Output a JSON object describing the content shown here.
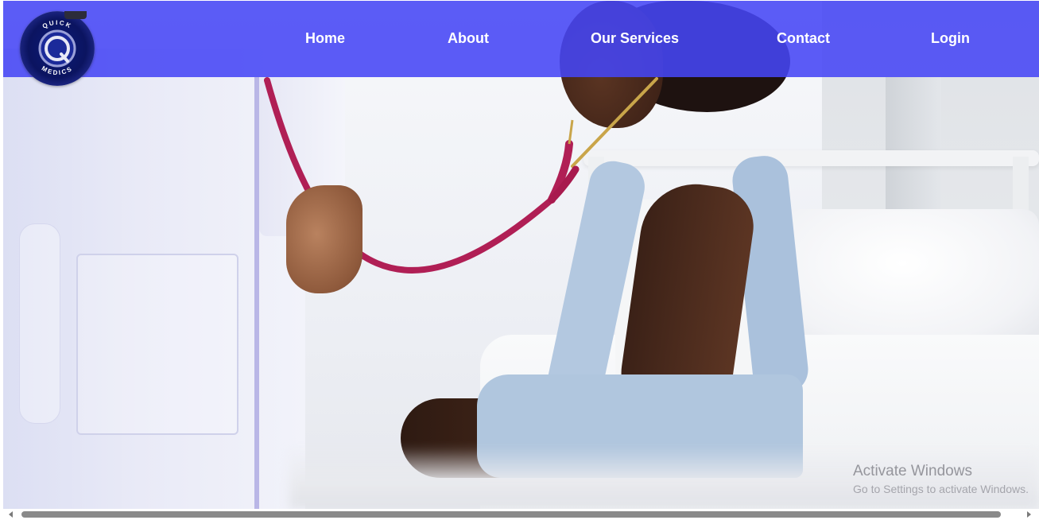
{
  "brand": {
    "logo_top_text": "QUICK",
    "logo_bottom_text": "MEDICS",
    "logo_letter": "Q"
  },
  "nav": {
    "items": [
      {
        "label": "Home"
      },
      {
        "label": "About"
      },
      {
        "label": "Our Services"
      },
      {
        "label": "Contact"
      },
      {
        "label": "Login"
      }
    ],
    "bar_color": "#4646f5"
  },
  "hero": {
    "image": "doctor-examining-child-stethoscope"
  },
  "watermark": {
    "title": "Activate Windows",
    "subtitle": "Go to Settings to activate Windows."
  }
}
